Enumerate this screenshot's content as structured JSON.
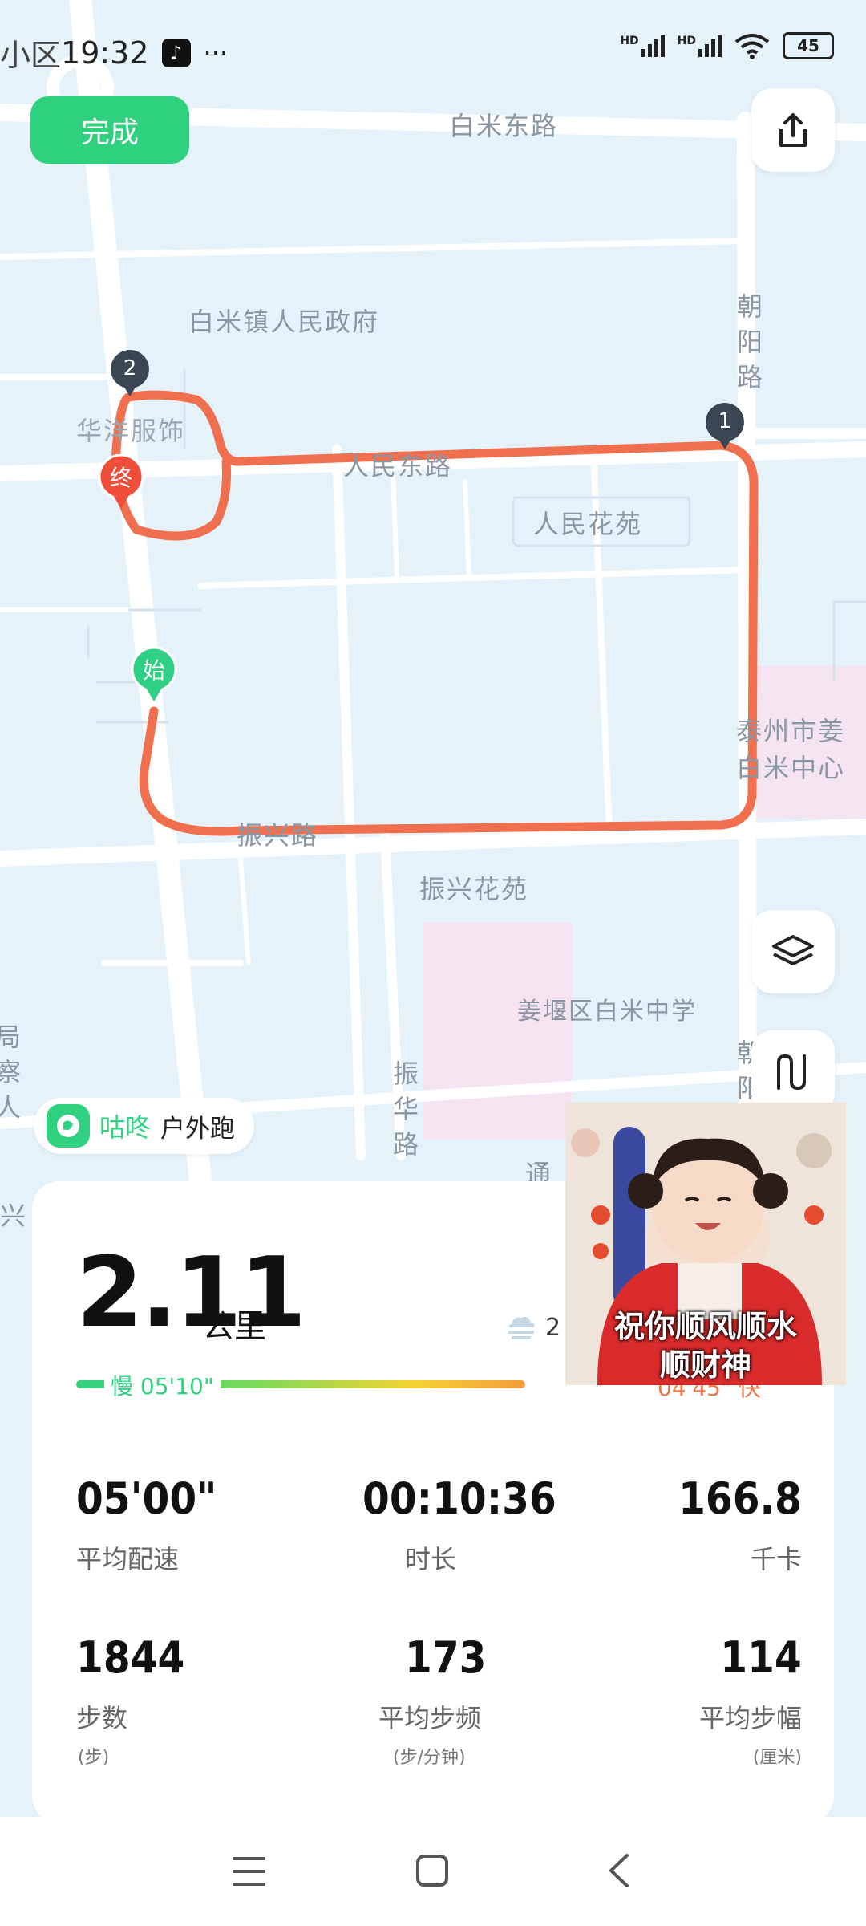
{
  "status": {
    "prev_text": "小区",
    "time": "19:32",
    "more": "···",
    "signal1": "HD",
    "signal2": "HD",
    "battery": "45"
  },
  "header": {
    "done_label": "完成"
  },
  "map": {
    "roads": {
      "baimi_east": "白米东路",
      "renmin_east": "人民东路",
      "zhenxing": "振兴路",
      "chaoyang": "朝阳路",
      "zhenhua": "振华路"
    },
    "places": {
      "gov": "白米镇人民政府",
      "clothing": "华洋服饰",
      "garden": "人民花苑",
      "zx_garden": "振兴花苑",
      "center_l1": "泰州市姜",
      "center_l2": "白米中心",
      "school": "姜堰区白米中学",
      "partial_tong": "通",
      "partial_left": "局察人",
      "partial_right": "朝阳",
      "partial_xing": "兴"
    },
    "markers": {
      "start": "始",
      "end": "终",
      "km1": "1",
      "km2": "2"
    },
    "colors": {
      "route": "#ef6f4f",
      "start": "#2fcf86",
      "end": "#ef4f3a"
    }
  },
  "brand": {
    "name": "咕咚",
    "activity": "户外跑"
  },
  "summary": {
    "distance": "2.11",
    "distance_unit": "公里",
    "weather_value": "2",
    "pace_slow_label": "慢 05'10\"",
    "pace_fast_label": "04'45\" 快"
  },
  "stats": [
    {
      "value": "05'00\"",
      "label": "平均配速",
      "sub": ""
    },
    {
      "value": "00:10:36",
      "label": "时长",
      "sub": ""
    },
    {
      "value": "166.8",
      "label": "千卡",
      "sub": ""
    },
    {
      "value": "1844",
      "label": "步数",
      "sub": "(步)"
    },
    {
      "value": "173",
      "label": "平均步频",
      "sub": "(步/分钟)"
    },
    {
      "value": "114",
      "label": "平均步幅",
      "sub": "(厘米)"
    }
  ],
  "video": {
    "caption_l1": "祝你顺风顺水",
    "caption_l2": "顺财神"
  }
}
